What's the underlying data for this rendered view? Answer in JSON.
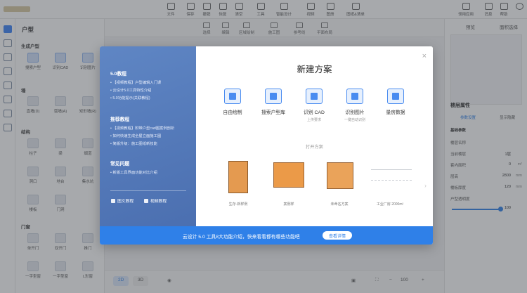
{
  "topbar": {
    "tools": [
      "文件",
      "保存",
      "撤销",
      "恢复",
      "清空",
      "工具",
      "智能设计",
      "视频",
      "图册",
      "图纸&清单"
    ],
    "right": [
      "领用应用",
      "消息",
      "帮助"
    ]
  },
  "left_panel": {
    "title": "户型",
    "section_generate": "生成户型",
    "generate_items": [
      "搜索户型",
      "识别CAD",
      "识别图片"
    ],
    "section_wall": "墙",
    "wall_items": [
      "直墙(D)",
      "弧墙(A)",
      "矩形墙(R)"
    ],
    "section_struct": "结构",
    "struct_items": [
      "柱子",
      "梁",
      "烟道",
      "洞口",
      "地台",
      "集水坑",
      "楼板",
      "门洞"
    ],
    "section_door": "门窗",
    "door_items": [
      "单开门",
      "双开门",
      "推门",
      "一字型窗",
      "一字型窗",
      "L形窗"
    ]
  },
  "canvas_toolbar": [
    "选择",
    "编辑",
    "区域绘制",
    "施工图",
    "参考线",
    "平面布局"
  ],
  "right_panel": {
    "tab_minimap": "预览",
    "tab_other": "面积选择",
    "props_title": "楼层属性",
    "props_tabs": [
      "参数设置",
      "显示隐藏"
    ],
    "section": "基础参数",
    "rows": [
      {
        "label": "楼层名称",
        "value": "",
        "unit": ""
      },
      {
        "label": "当前楼层",
        "value": "1层",
        "unit": ""
      },
      {
        "label": "套内面积",
        "value": "0",
        "unit": "m²"
      },
      {
        "label": "层高",
        "value": "2800",
        "unit": "mm"
      },
      {
        "label": "楼板厚度",
        "value": "120",
        "unit": "mm"
      },
      {
        "label": "户型透明度",
        "value": "",
        "unit": ""
      }
    ],
    "slider_value": "100"
  },
  "bottombar": {
    "view_2d": "2D",
    "view_3d": "3D",
    "zoom": "100"
  },
  "modal": {
    "title": "新建方案",
    "close": "×",
    "left": {
      "section1_title": "5.0教程",
      "section1_items": [
        "【视频教程】户型编辑入门课",
        "云设计5.0工具特性介绍",
        "5.0功能提示(关联教程)"
      ],
      "section2_title": "推荐教程",
      "section2_items": [
        "【视频教程】附带户型cad图案例剖析",
        "如何快速生成全屋立面施工图",
        "简版升级：施工图纸新技能"
      ],
      "section3_title": "常见问题",
      "section3_items": [
        "新版工具界面功能对比介绍"
      ],
      "link_text": "图文教程",
      "link_video": "视频教程"
    },
    "options": [
      {
        "label": "自由绘制",
        "sub": ""
      },
      {
        "label": "搜索户型库",
        "sub": ""
      },
      {
        "label": "识别 CAD",
        "sub": "上传要求"
      },
      {
        "label": "识别图片",
        "sub": "一键自动识别"
      },
      {
        "label": "量房数据",
        "sub": ""
      }
    ],
    "open_title": "打开方案",
    "cards": [
      "生存·新样例",
      "案例样",
      "未命名方案",
      "工业厂房 2000m²"
    ],
    "banner_text": "云设计 5.0 工具8大功能介绍，快来看看都有哪些功能吧",
    "banner_button": "查看详情"
  }
}
